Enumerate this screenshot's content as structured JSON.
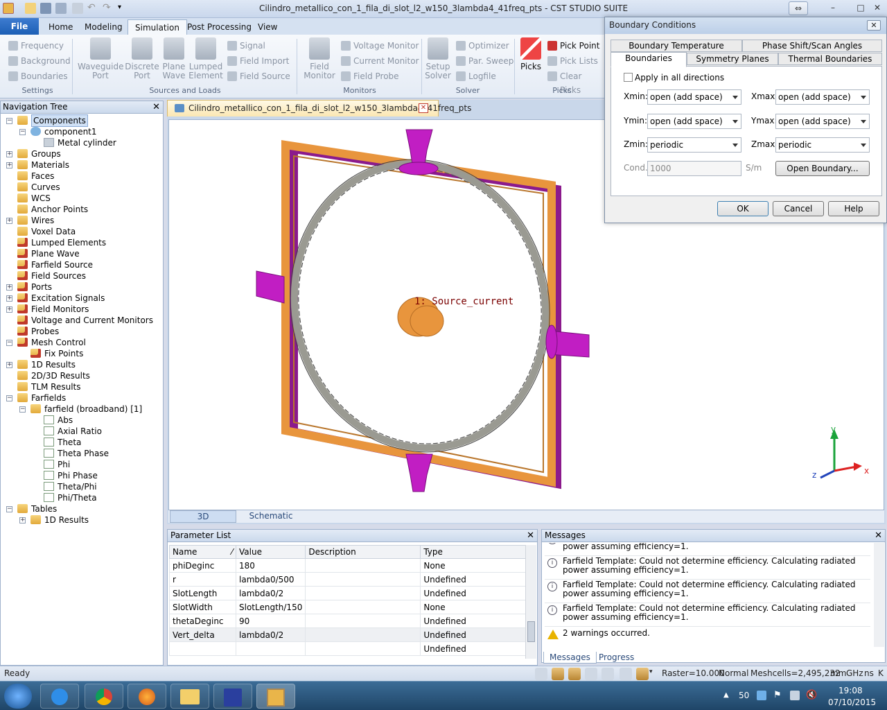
{
  "app": {
    "title": "Cilindro_metallico_con_1_fila_di_slot_l2_w150_3lambda4_41freq_pts - CST STUDIO SUITE"
  },
  "ribbon": {
    "file": "File",
    "tabs": [
      "Home",
      "Modeling",
      "Simulation",
      "Post Processing",
      "View"
    ],
    "active_tab": "Simulation",
    "settings": {
      "frequency": "Frequency",
      "background": "Background",
      "boundaries": "Boundaries",
      "label": "Settings"
    },
    "sources": {
      "waveguide_port": "Waveguide Port",
      "discrete_port": "Discrete Port",
      "plane_wave": "Plane Wave",
      "lumped_element": "Lumped Element",
      "signal": "Signal",
      "field_import": "Field Import",
      "field_source": "Field Source",
      "label": "Sources and Loads"
    },
    "monitors": {
      "field_monitor": "Field Monitor",
      "voltage_monitor": "Voltage Monitor",
      "current_monitor": "Current Monitor",
      "field_probe": "Field Probe",
      "label": "Monitors"
    },
    "solver": {
      "setup_solver": "Setup Solver",
      "optimizer": "Optimizer",
      "par_sweep": "Par. Sweep",
      "logfile": "Logfile",
      "label": "Solver"
    },
    "picks": {
      "picks": "Picks",
      "pick_point": "Pick Point",
      "pick_lists": "Pick Lists",
      "clear_picks": "Clear Picks",
      "label": "Picks"
    }
  },
  "nav": {
    "title": "Navigation Tree",
    "items": [
      {
        "label": "Components",
        "level": 0,
        "icon": "folder",
        "tw": "-",
        "sel": true
      },
      {
        "label": "component1",
        "level": 1,
        "icon": "component",
        "tw": "-"
      },
      {
        "label": "Metal cylinder",
        "level": 2,
        "icon": "material",
        "tw": ""
      },
      {
        "label": "Groups",
        "level": 0,
        "icon": "folder",
        "tw": "+"
      },
      {
        "label": "Materials",
        "level": 0,
        "icon": "folder",
        "tw": "+"
      },
      {
        "label": "Faces",
        "level": 0,
        "icon": "folder",
        "tw": ""
      },
      {
        "label": "Curves",
        "level": 0,
        "icon": "folder",
        "tw": ""
      },
      {
        "label": "WCS",
        "level": 0,
        "icon": "folder",
        "tw": ""
      },
      {
        "label": "Anchor Points",
        "level": 0,
        "icon": "folder",
        "tw": ""
      },
      {
        "label": "Wires",
        "level": 0,
        "icon": "folder",
        "tw": "+"
      },
      {
        "label": "Voxel Data",
        "level": 0,
        "icon": "folder",
        "tw": ""
      },
      {
        "label": "Lumped Elements",
        "level": 0,
        "icon": "folder-red",
        "tw": ""
      },
      {
        "label": "Plane Wave",
        "level": 0,
        "icon": "folder-red",
        "tw": ""
      },
      {
        "label": "Farfield Source",
        "level": 0,
        "icon": "folder-red",
        "tw": ""
      },
      {
        "label": "Field Sources",
        "level": 0,
        "icon": "folder-red",
        "tw": ""
      },
      {
        "label": "Ports",
        "level": 0,
        "icon": "folder-red",
        "tw": "+"
      },
      {
        "label": "Excitation Signals",
        "level": 0,
        "icon": "folder-red",
        "tw": "+"
      },
      {
        "label": "Field Monitors",
        "level": 0,
        "icon": "folder-red",
        "tw": "+"
      },
      {
        "label": "Voltage and Current Monitors",
        "level": 0,
        "icon": "folder-red",
        "tw": ""
      },
      {
        "label": "Probes",
        "level": 0,
        "icon": "folder-red",
        "tw": ""
      },
      {
        "label": "Mesh Control",
        "level": 0,
        "icon": "folder-red",
        "tw": "-"
      },
      {
        "label": "Fix Points",
        "level": 1,
        "icon": "folder-red",
        "tw": ""
      },
      {
        "label": "1D Results",
        "level": 0,
        "icon": "folder",
        "tw": "+"
      },
      {
        "label": "2D/3D Results",
        "level": 0,
        "icon": "folder",
        "tw": ""
      },
      {
        "label": "TLM Results",
        "level": 0,
        "icon": "folder",
        "tw": ""
      },
      {
        "label": "Farfields",
        "level": 0,
        "icon": "folder",
        "tw": "-"
      },
      {
        "label": "farfield (broadband) [1]",
        "level": 1,
        "icon": "folder",
        "tw": "-"
      },
      {
        "label": "Abs",
        "level": 2,
        "icon": "farfield",
        "tw": ""
      },
      {
        "label": "Axial Ratio",
        "level": 2,
        "icon": "farfield",
        "tw": ""
      },
      {
        "label": "Theta",
        "level": 2,
        "icon": "farfield",
        "tw": ""
      },
      {
        "label": "Theta Phase",
        "level": 2,
        "icon": "farfield",
        "tw": ""
      },
      {
        "label": "Phi",
        "level": 2,
        "icon": "farfield",
        "tw": ""
      },
      {
        "label": "Phi Phase",
        "level": 2,
        "icon": "farfield",
        "tw": ""
      },
      {
        "label": "Theta/Phi",
        "level": 2,
        "icon": "farfield",
        "tw": ""
      },
      {
        "label": "Phi/Theta",
        "level": 2,
        "icon": "farfield",
        "tw": ""
      },
      {
        "label": "Tables",
        "level": 0,
        "icon": "folder",
        "tw": "-"
      },
      {
        "label": "1D Results",
        "level": 1,
        "icon": "folder",
        "tw": "+"
      }
    ]
  },
  "document": {
    "tab": "Cilindro_metallico_con_1_fila_di_slot_l2_w150_3lambda4_41freq_pts",
    "source_label": "1: Source_current",
    "view_tabs": [
      "3D",
      "Schematic"
    ],
    "axes": {
      "x": "x",
      "y": "y",
      "z": "z"
    }
  },
  "params": {
    "title": "Parameter List",
    "columns": [
      "Name",
      "Value",
      "Description",
      "Type"
    ],
    "rows": [
      [
        "phiDeginc",
        "180",
        "",
        "None"
      ],
      [
        "r",
        "lambda0/500",
        "",
        "Undefined"
      ],
      [
        "SlotLength",
        "lambda0/2",
        "",
        "Undefined"
      ],
      [
        "SlotWidth",
        "SlotLength/150",
        "",
        "None"
      ],
      [
        "thetaDeginc",
        "90",
        "",
        "Undefined"
      ],
      [
        "Vert_delta",
        "lambda0/2",
        "",
        "Undefined"
      ],
      [
        "",
        "",
        "",
        "Undefined"
      ]
    ]
  },
  "messages": {
    "title": "Messages",
    "items": [
      {
        "text": "Farfield Template: Could not determine efficiency. Calculating radiated power assuming efficiency=1.",
        "kind": "info"
      },
      {
        "text": "Farfield Template: Could not determine efficiency. Calculating radiated power assuming efficiency=1.",
        "kind": "info"
      },
      {
        "text": "Farfield Template: Could not determine efficiency. Calculating radiated power assuming efficiency=1.",
        "kind": "info"
      },
      {
        "text": "Farfield Template: Could not determine efficiency. Calculating radiated power assuming efficiency=1.",
        "kind": "info"
      },
      {
        "text": "2 warnings occurred.",
        "kind": "warning"
      }
    ],
    "tabs": [
      "Messages",
      "Progress"
    ]
  },
  "dialog": {
    "title": "Boundary Conditions",
    "tabs_row1": [
      "Boundary Temperature",
      "Phase Shift/Scan Angles"
    ],
    "tabs_row2": [
      "Boundaries",
      "Symmetry Planes",
      "Thermal Boundaries"
    ],
    "apply_all": "Apply in all directions",
    "xmin_label": "Xmin:",
    "xmin": "open (add space)",
    "xmax_label": "Xmax:",
    "xmax": "open (add space)",
    "ymin_label": "Ymin:",
    "ymin": "open (add space)",
    "ymax_label": "Ymax:",
    "ymax": "open (add space)",
    "zmin_label": "Zmin:",
    "zmin": "periodic",
    "zmax_label": "Zmax:",
    "zmax": "periodic",
    "cond_label": "Cond.:",
    "cond": "1000",
    "cond_unit": "S/m",
    "open_boundary": "Open Boundary...",
    "ok": "OK",
    "cancel": "Cancel",
    "help": "Help"
  },
  "status": {
    "ready": "Ready",
    "raster": "Raster=10.000",
    "mode": "Normal",
    "meshcells": "Meshcells=2,495,232",
    "units": [
      "mm",
      "GHz",
      "ns",
      "K"
    ]
  },
  "taskbar": {
    "tray_num": "50",
    "time": "19:08",
    "date": "07/10/2015"
  },
  "colors": {
    "frame_orange": "#e8953d",
    "frame_purple": "#8b1a8c",
    "port_magenta": "#c11ec3",
    "ring_gray": "#9a9a92"
  }
}
